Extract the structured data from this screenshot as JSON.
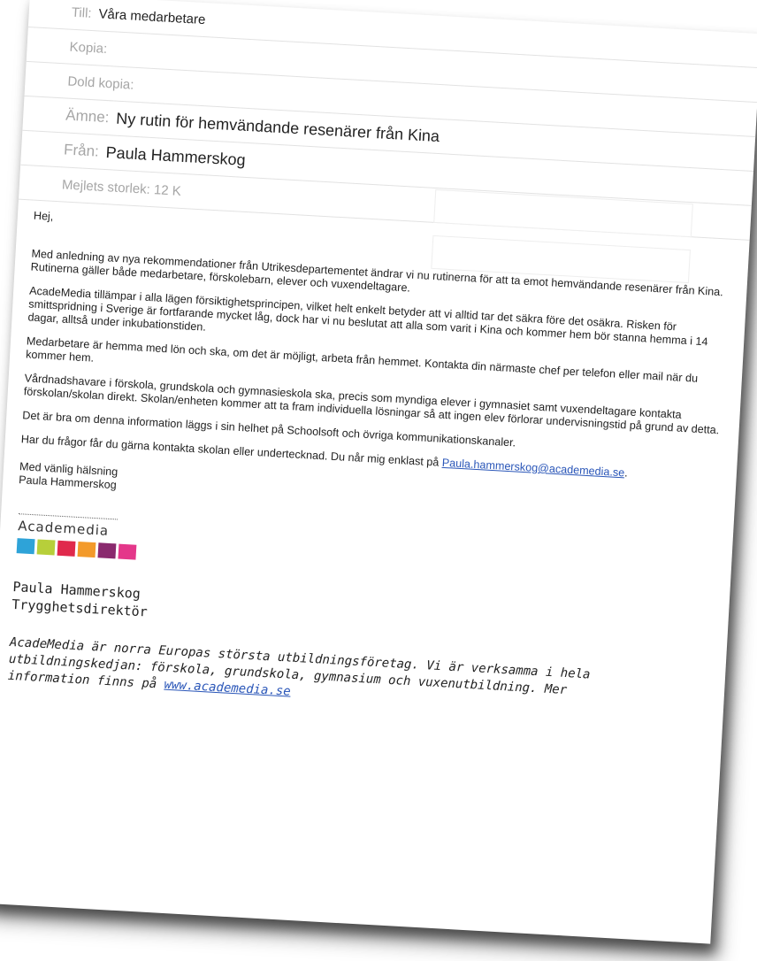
{
  "header": {
    "to_label": "Till:",
    "to_value": "Våra medarbetare",
    "cc_label": "Kopia:",
    "bcc_label": "Dold kopia:",
    "subject_label": "Ämne:",
    "subject_value": "Ny rutin för hemvändande resenärer från Kina",
    "from_label": "Från:",
    "from_value": "Paula Hammerskog",
    "size_text": "Mejlets storlek: 12 K"
  },
  "body": {
    "greeting": "Hej,",
    "p1": "Med anledning av nya rekommendationer från Utrikesdepartementet ändrar vi nu rutinerna för att ta emot hemvändande resenärer från Kina. Rutinerna gäller både medarbetare, förskolebarn, elever och vuxendeltagare.",
    "p2": "AcadeMedia tillämpar i alla lägen försiktighetsprincipen, vilket helt enkelt betyder att vi alltid tar det säkra före det osäkra. Risken för smittspridning i Sverige är fortfarande mycket låg, dock har vi nu beslutat att alla som varit i Kina och kommer hem bör stanna hemma i 14 dagar, alltså under inkubationstiden.",
    "p3": "Medarbetare är hemma med lön och ska, om det är möjligt, arbeta från hemmet. Kontakta din närmaste chef per telefon eller mail när du kommer hem.",
    "p4": "Vårdnadshavare i förskola, grundskola och gymnasieskola ska, precis som myndiga elever i gymnasiet samt vuxendeltagare kontakta förskolan/skolan direkt. Skolan/enheten kommer att ta fram individuella lösningar så att ingen elev förlorar undervisningstid på grund av detta.",
    "p5": "Det är bra om denna information läggs i sin helhet på Schoolsoft och övriga kommunikationskanaler.",
    "p6_text": "Har du frågor får du gärna kontakta skolan eller undertecknad.  Du når mig enklast på",
    "p6_email": "Paula.hammerskog@academedia.se",
    "p6_end": ".",
    "closing": "Med vänlig hälsning",
    "closing_name": "Paula Hammerskog"
  },
  "signature": {
    "logo": "Academedia",
    "colors": [
      "#2ea3d8",
      "#b7cf3a",
      "#e0294c",
      "#f39a2a",
      "#8a2a6e",
      "#e4378a"
    ],
    "name": "Paula Hammerskog",
    "title": "Trygghetsdirektör"
  },
  "footer": {
    "text": "AcadeMedia är norra Europas största utbildningsföretag. Vi är verksamma i hela utbildningskedjan: förskola, grundskola, gymnasium och vuxenutbildning. Mer information finns på",
    "link": "www.academedia.se"
  }
}
